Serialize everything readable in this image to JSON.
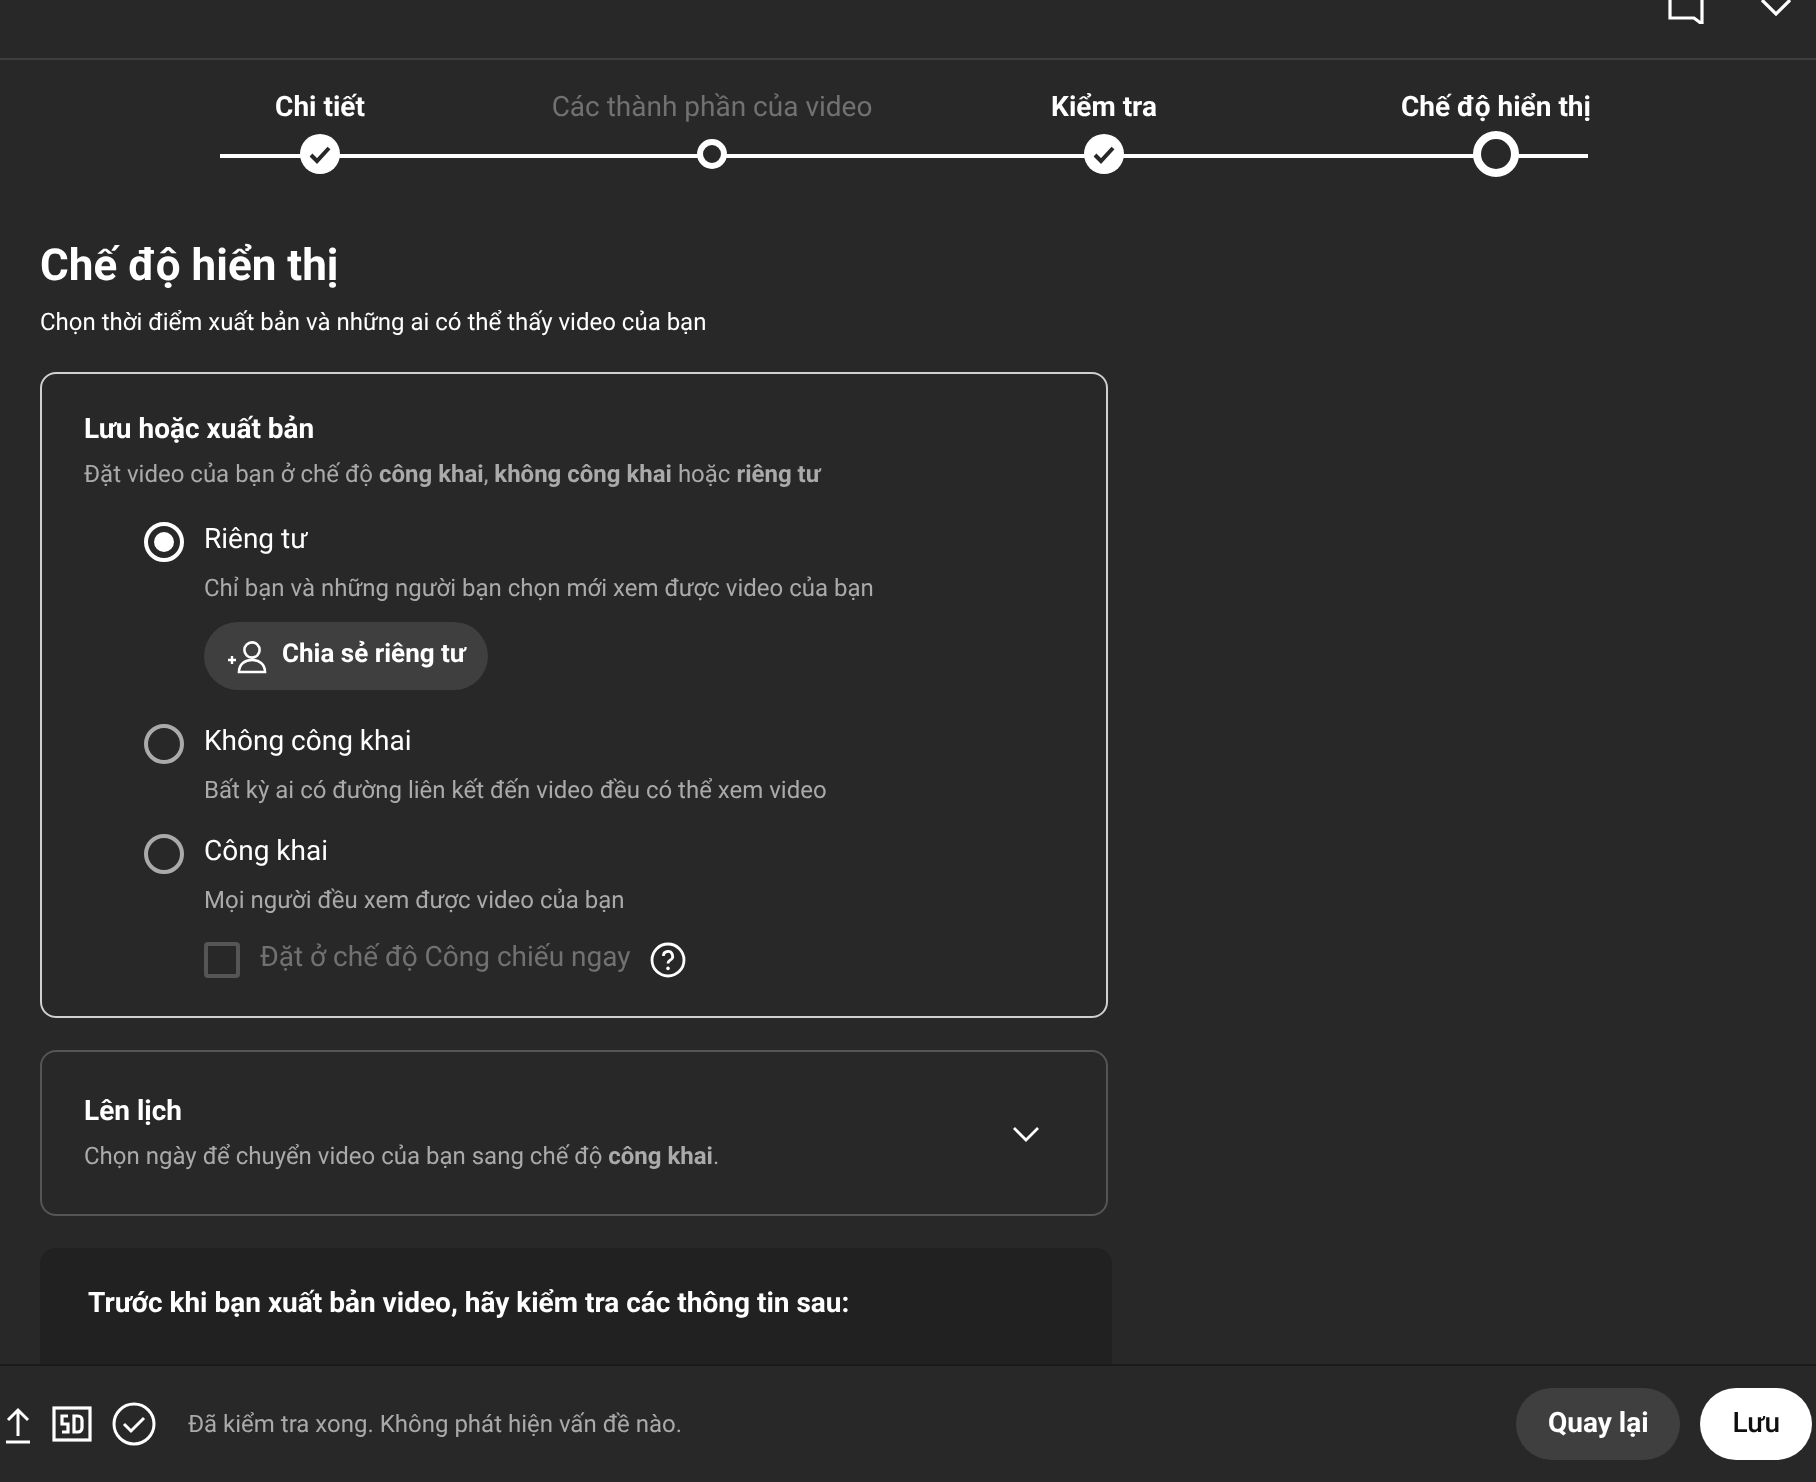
{
  "steps": [
    {
      "label": "Chi tiết",
      "kind": "done"
    },
    {
      "label": "Các thành phần của video",
      "kind": "pending"
    },
    {
      "label": "Kiểm tra",
      "kind": "done"
    },
    {
      "label": "Chế độ hiển thị",
      "kind": "current"
    }
  ],
  "heading": "Chế độ hiển thị",
  "subheading": "Chọn thời điểm xuất bản và những ai có thể thấy video của bạn",
  "save_publish": {
    "title": "Lưu hoặc xuất bản",
    "description": "Đặt video của bạn ở chế độ **công khai**, **không công khai** hoặc **riêng tư**",
    "options": [
      {
        "label": "Riêng tư",
        "description": "Chỉ bạn và những người bạn chọn mới xem được video của bạn",
        "selected": true,
        "share_button": "Chia sẻ riêng tư"
      },
      {
        "label": "Không công khai",
        "description": "Bất kỳ ai có đường liên kết đến video đều có thể xem video",
        "selected": false
      },
      {
        "label": "Công khai",
        "description": "Mọi người đều xem được video của bạn",
        "selected": false,
        "premiere": {
          "label": "Đặt ở chế độ Công chiếu ngay",
          "checked": false,
          "disabled": true
        }
      }
    ]
  },
  "schedule": {
    "title": "Lên lịch",
    "description": "Chọn ngày để chuyển video của bạn sang chế độ **công khai**.",
    "expanded": false
  },
  "checklist": {
    "title": "Trước khi bạn xuất bản video, hãy kiểm tra các thông tin sau:"
  },
  "footer": {
    "status": "Đã kiểm tra xong. Không phát hiện vấn đề nào.",
    "buttons": [
      {
        "label": "Quay lại",
        "kind": "secondary"
      },
      {
        "label": "Lưu",
        "kind": "primary"
      }
    ]
  }
}
